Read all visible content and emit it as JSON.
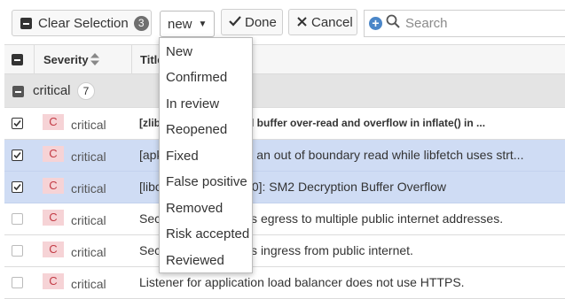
{
  "toolbar": {
    "clear_selection_label": "Clear Selection",
    "selection_count": "3",
    "status_value": "new",
    "done_label": "Done",
    "cancel_label": "Cancel",
    "search_placeholder": "Search"
  },
  "table": {
    "columns": [
      "Severity",
      "Title"
    ],
    "group": {
      "label": "critical",
      "count": "7"
    },
    "rows": [
      {
        "severity_letter": "C",
        "severity": "critical",
        "title": "[zlib]: zlib: heap-based buffer over-read and overflow in inflate() in ...",
        "selected": false,
        "checked": true
      },
      {
        "severity_letter": "C",
        "severity": "critical",
        "title": "[apk-tools 2.12.7-r0]: an out of boundary read while libfetch uses strt...",
        "selected": true,
        "checked": true
      },
      {
        "severity_letter": "C",
        "severity": "critical",
        "title": "[libcrypto1.1 1.1.1k-r0]: SM2 Decryption Buffer Overflow",
        "selected": true,
        "checked": true
      },
      {
        "severity_letter": "C",
        "severity": "critical",
        "title": "Security group allows egress to multiple public internet addresses.",
        "selected": false,
        "checked": false
      },
      {
        "severity_letter": "C",
        "severity": "critical",
        "title": "Security group allows ingress from public internet.",
        "selected": false,
        "checked": false
      },
      {
        "severity_letter": "C",
        "severity": "critical",
        "title": "Listener for application load balancer does not use HTTPS.",
        "selected": false,
        "checked": false
      }
    ]
  },
  "dropdown": {
    "options": [
      "New",
      "Confirmed",
      "In review",
      "Reopened",
      "Fixed",
      "False positive",
      "Removed",
      "Risk accepted",
      "Reviewed"
    ]
  },
  "colors": {
    "selected_row": "#cfdcf4",
    "severity_badge_bg": "#f6d3d6",
    "severity_badge_text": "#c23a44",
    "accent_blue": "#4a86c8"
  }
}
